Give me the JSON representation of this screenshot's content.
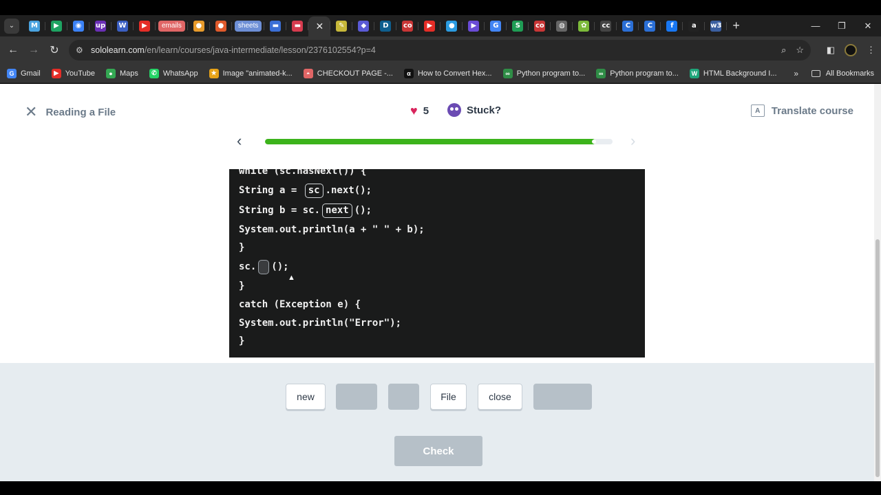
{
  "browser": {
    "tabs": [
      {
        "icon": "gmail-icon",
        "glyph": "M",
        "color": "#4aa3df"
      },
      {
        "icon": "play-icon",
        "glyph": "▶",
        "color": "#1ea362"
      },
      {
        "icon": "circle-c-icon",
        "glyph": "◉",
        "color": "#3b82f6"
      },
      {
        "icon": "upwork-icon",
        "glyph": "up",
        "color": "#6a2fb5"
      },
      {
        "icon": "doc-icon",
        "glyph": "W",
        "color": "#3b5fc2"
      },
      {
        "icon": "youtube-icon",
        "glyph": "▶",
        "color": "#e52d27"
      },
      {
        "label": "emails",
        "color": "#e06666"
      },
      {
        "icon": "maps-icon",
        "glyph": "●",
        "color": "#e89b2b"
      },
      {
        "icon": "maps-icon",
        "glyph": "●",
        "color": "#e05a2b"
      },
      {
        "label": "sheets",
        "color": "#6d8fd6"
      },
      {
        "icon": "blue-bar-icon",
        "glyph": "▬",
        "color": "#3b6fd6"
      },
      {
        "icon": "red-bar-icon",
        "glyph": "▬",
        "color": "#d63b4e"
      },
      {
        "icon": "close-icon",
        "glyph": "✕",
        "active": true
      },
      {
        "icon": "pencil-icon",
        "glyph": "✎",
        "color": "#c7b83a"
      },
      {
        "icon": "puzzle-icon",
        "glyph": "◆",
        "color": "#5a5ad6"
      },
      {
        "icon": "d-icon",
        "glyph": "D",
        "color": "#0f5f8f"
      },
      {
        "icon": "co-icon",
        "glyph": "co",
        "color": "#c93636"
      },
      {
        "icon": "youtube-icon",
        "glyph": "▶",
        "color": "#e52d27"
      },
      {
        "icon": "maps-icon",
        "glyph": "●",
        "color": "#2b9be0"
      },
      {
        "icon": "video-icon",
        "glyph": "▶",
        "color": "#6a4bd6"
      },
      {
        "icon": "google-icon",
        "glyph": "G",
        "color": "#4285f4"
      },
      {
        "icon": "s-icon",
        "glyph": "S",
        "color": "#1f9d55"
      },
      {
        "icon": "co-icon",
        "glyph": "co",
        "color": "#c93636"
      },
      {
        "icon": "globe-icon",
        "glyph": "◍",
        "color": "#666"
      },
      {
        "icon": "green-icon",
        "glyph": "✿",
        "color": "#7cba3a"
      },
      {
        "icon": "cc-icon",
        "glyph": "cc",
        "color": "#444"
      },
      {
        "icon": "c-icon",
        "glyph": "C",
        "color": "#2b6fd6"
      },
      {
        "icon": "c-icon",
        "glyph": "C",
        "color": "#2b6fd6"
      },
      {
        "icon": "facebook-icon",
        "glyph": "f",
        "color": "#1877f2"
      },
      {
        "icon": "amazon-icon",
        "glyph": "a",
        "color": "#222"
      },
      {
        "icon": "w3-icon",
        "glyph": "w3",
        "color": "#3b5fa0"
      }
    ],
    "new_tab": "+",
    "window_controls": {
      "minimize": "—",
      "maximize": "❐",
      "close": "✕"
    },
    "nav": {
      "back": "←",
      "forward": "→",
      "reload": "↻"
    },
    "url_host": "sololearn.com",
    "url_path": "/en/learn/courses/java-intermediate/lesson/2376102554?p=4",
    "bookmarks": [
      {
        "label": "Gmail",
        "icon": "google-icon",
        "glyph": "G",
        "color": "#4285f4"
      },
      {
        "label": "YouTube",
        "icon": "youtube-icon",
        "glyph": "▶",
        "color": "#e52d27"
      },
      {
        "label": "Maps",
        "icon": "maps-icon",
        "glyph": "●",
        "color": "#34a853"
      },
      {
        "label": "WhatsApp",
        "icon": "whatsapp-icon",
        "glyph": "✆",
        "color": "#25d366"
      },
      {
        "label": "Image \"animated-k...",
        "icon": "star-icon",
        "glyph": "★",
        "color": "#e8a317"
      },
      {
        "label": "CHECKOUT PAGE -...",
        "icon": "pill-icon",
        "glyph": "◓",
        "color": "#e06666"
      },
      {
        "label": "How to Convert Hex...",
        "icon": "alpha-icon",
        "glyph": "α",
        "color": "#111"
      },
      {
        "label": "Python program to...",
        "icon": "gfg-icon",
        "glyph": "∞",
        "color": "#2f8d46"
      },
      {
        "label": "Python program to...",
        "icon": "gfg-icon",
        "glyph": "∞",
        "color": "#2f8d46"
      },
      {
        "label": "HTML Background I...",
        "icon": "w-icon",
        "glyph": "W",
        "color": "#1fa67a"
      }
    ],
    "bookmarks_more": "»",
    "all_bookmarks": "All Bookmarks"
  },
  "lesson": {
    "title": "Reading a File",
    "hearts": "5",
    "stuck": "Stuck?",
    "translate": "Translate course",
    "progress_fraction": 0.95
  },
  "code": {
    "line0": "while (sc.hasNext()) {",
    "line1_pre": "String a = ",
    "line1_chip": "sc",
    "line1_post": ".next();",
    "line2_pre": "String b = sc.",
    "line2_chip": "next",
    "line2_post": "();",
    "line3": "System.out.println(a + \" \" + b);",
    "line4": "}",
    "line5_pre": "sc.",
    "line5_post": "();",
    "line6": "}",
    "line7": "catch (Exception e) {",
    "line8": "System.out.println(\"Error\");",
    "line9": "}"
  },
  "options": {
    "opt1": "new",
    "opt2": "",
    "opt3": "",
    "opt4": "File",
    "opt5": "close",
    "opt6": ""
  },
  "check_label": "Check"
}
